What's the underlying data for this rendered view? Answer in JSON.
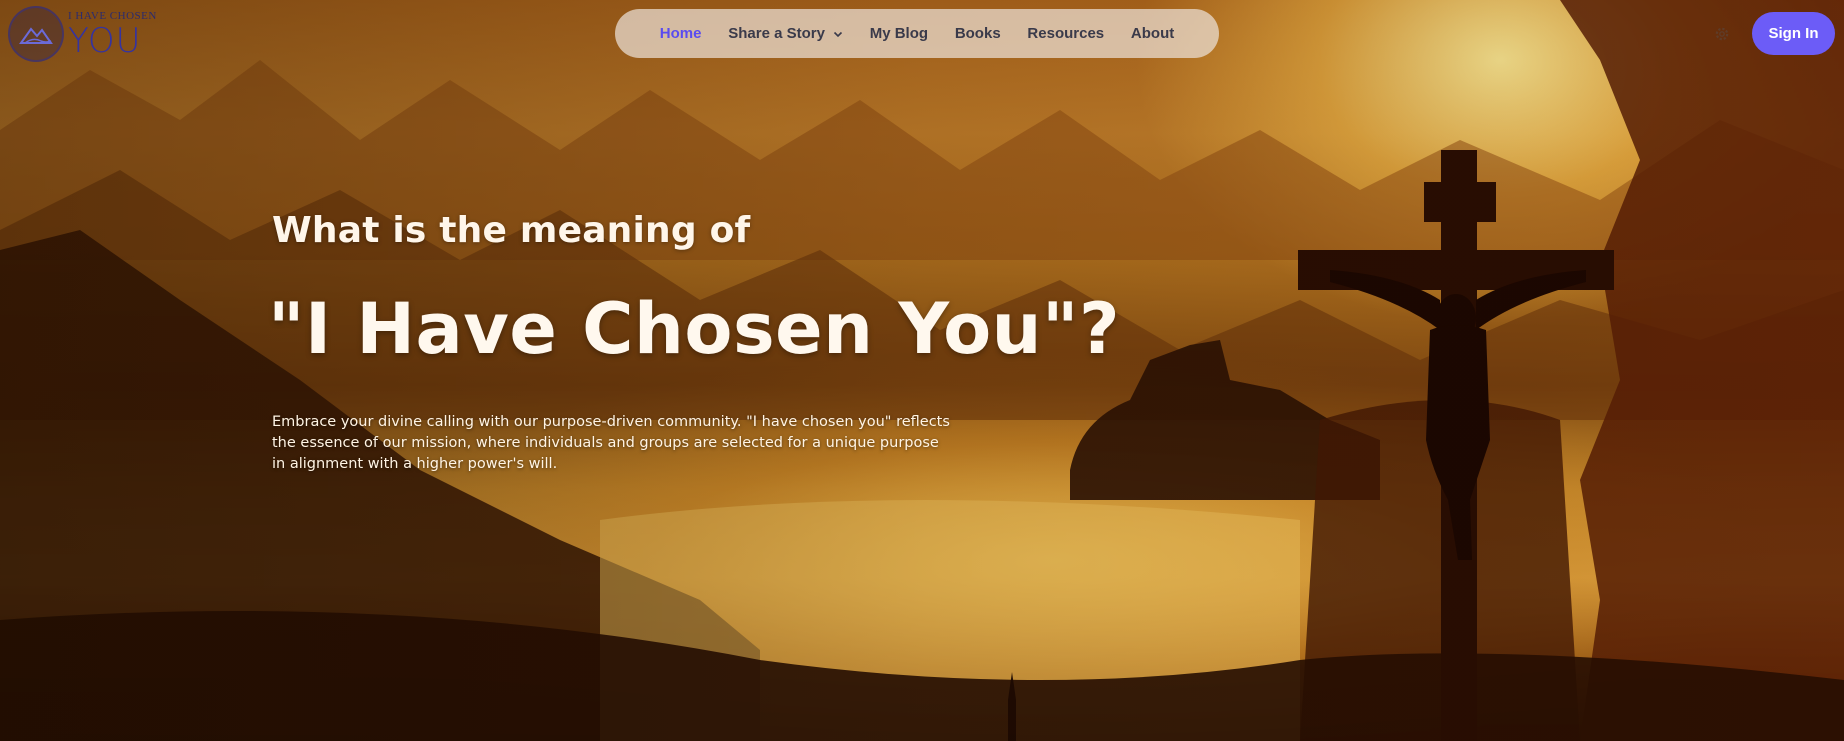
{
  "brand": {
    "small_text": "I HAVE CHOSEN",
    "big_text": "YOU",
    "logo_icon": "mountain-icon"
  },
  "nav": {
    "items": [
      {
        "label": "Home",
        "active": true
      },
      {
        "label": "Share a Story",
        "has_dropdown": true
      },
      {
        "label": "My Blog"
      },
      {
        "label": "Books"
      },
      {
        "label": "Resources"
      },
      {
        "label": "About"
      }
    ]
  },
  "header_actions": {
    "settings_icon": "gear-icon",
    "sign_in_label": "Sign In"
  },
  "hero": {
    "kicker": "What is the meaning of",
    "headline": "\"I Have Chosen You\"?",
    "description": "Embrace your divine calling with our purpose-driven community. \"I have chosen you\" reflects the essence of our mission, where individuals and groups are selected for a unique purpose in alignment with a higher power's will."
  },
  "colors": {
    "accent": "#6c5cf7",
    "active_nav": "#5a4cf0",
    "nav_text": "#3a3a4a"
  }
}
